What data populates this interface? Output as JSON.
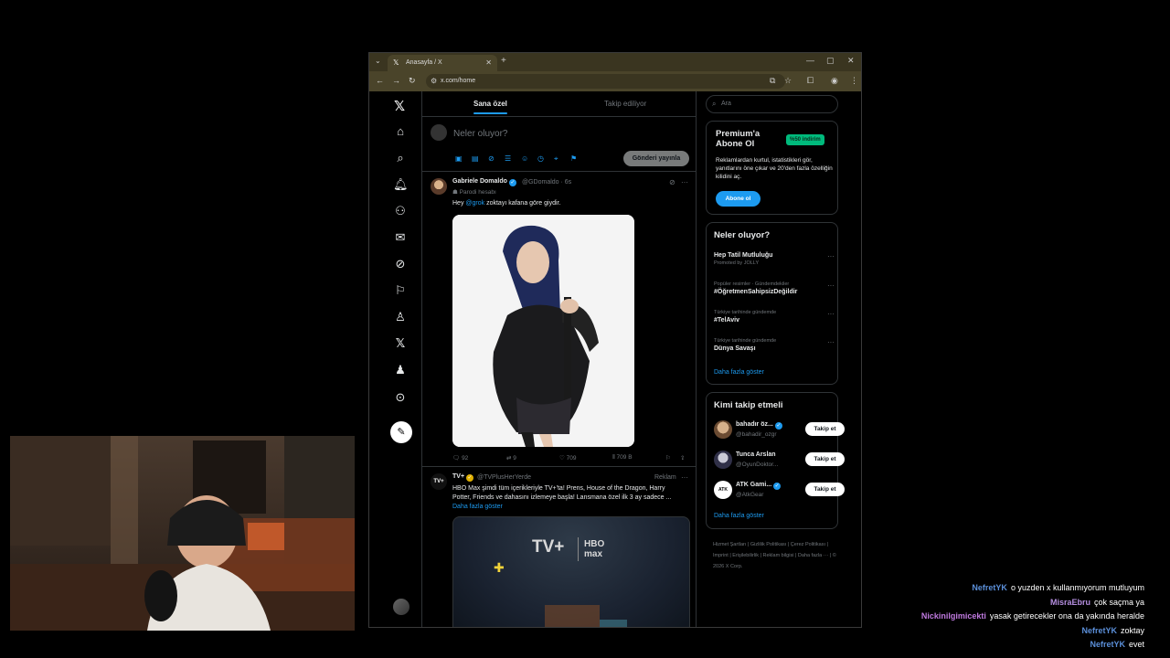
{
  "browser": {
    "tab_title": "Anasayfa / X",
    "url": "x.com/home",
    "new_tab": "+",
    "controls": [
      "—",
      "▢",
      "✕"
    ]
  },
  "x_page": {
    "feed_tabs": [
      "Sana özel",
      "Takip ediliyor"
    ],
    "composer": {
      "placeholder": "Neler oluyor?",
      "post_button": "Gönderi yayınla"
    },
    "tweet1": {
      "name": "Gabriele Domaldo",
      "handle": "@GDomaldo · 6s",
      "badge": "Parodi hesabı",
      "text_mention": "@grok",
      "text_prefix": "Hey ",
      "text_suffix": " zoktayı kafana göre giydir.",
      "replies": "92",
      "reposts": "9",
      "likes": "709",
      "views": "709 B"
    },
    "tweet2": {
      "avatar_text": "TV+",
      "name": "TV+",
      "handle": "@TVPlusHerYerde",
      "ad_label": "Reklam",
      "text": "HBO Max şimdi tüm içerikleriyle TV+'ta! Prens, House of the Dragon, Harry Potter, Friends ve dahasını izlemeye başla! Lansmana özel ilk 3 ay sadece ...",
      "show_more": "Daha fazla göster",
      "media_logo_left": "TV+",
      "media_logo_right": "HBO max"
    },
    "sidebar": {
      "search_placeholder": "Ara",
      "premium": {
        "title": "Premium'a Abone Ol",
        "badge": "%50 indirim",
        "description": "Reklamlardan kurtul, istatistikleri gör, yanıtlarını öne çıkar ve 20'den fazla özelliğin kilidini aç.",
        "button": "Abone ol"
      },
      "trends": {
        "title": "Neler oluyor?",
        "items": [
          {
            "category": "Promoted by JOLLY",
            "name": "Hep Tatil Mutluluğu"
          },
          {
            "category": "Popüler resimler · Gündemdekiler",
            "name": "#ÖğretmenSahipsizDeğildir"
          },
          {
            "category": "Türkiye tarihinde gündemde",
            "name": "#TelAviv"
          },
          {
            "category": "Türkiye tarihinde gündemde",
            "name": "Dünya Savaşı"
          }
        ],
        "show_more": "Daha fazla göster"
      },
      "who_to_follow": {
        "title": "Kimi takip etmeli",
        "users": [
          {
            "name": "bahadır öz...",
            "handle": "@bahadir_ozgr",
            "button": "Takip et"
          },
          {
            "name": "Tunca Arslan",
            "handle": "@OyunDoktor...",
            "button": "Takip et"
          },
          {
            "name": "ATK Gami...",
            "handle": "@AtkGear",
            "button": "Takip et"
          }
        ],
        "show_more": "Daha fazla göster"
      },
      "footer": "Hizmet Şartları | Gizlilik Politikası | Çerez Politikası | Imprint | Erişilebilirlik | Reklam bilgisi | Daha fazla ··· | © 2026 X Corp."
    }
  },
  "chat": [
    {
      "user": "NefretYK",
      "color": "#5b8fd9",
      "message": "o yuzden x kullanmıyorum mutluyum"
    },
    {
      "user": "MisraEbru",
      "color": "#b58ee0",
      "message": "çok saçma ya"
    },
    {
      "user": "Nickinilgimicekti",
      "color": "#c07ae0",
      "message": "yasak getirecekler ona da yakında heralde"
    },
    {
      "user": "NefretYK",
      "color": "#5b8fd9",
      "message": "zoktay"
    },
    {
      "user": "NefretYK",
      "color": "#5b8fd9",
      "message": "evet"
    }
  ]
}
